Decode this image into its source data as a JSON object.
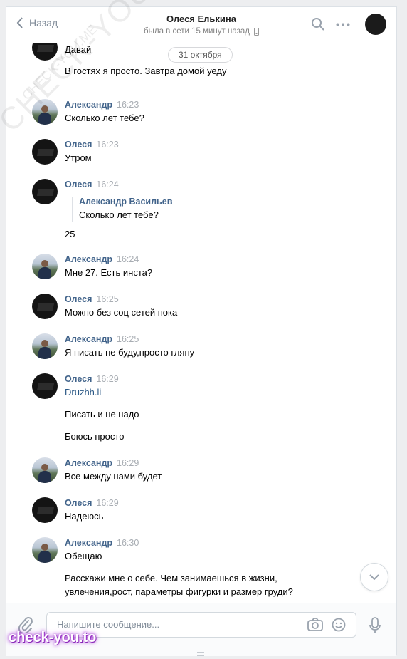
{
  "header": {
    "back_label": "Назад",
    "peer_name": "Олеся Елькина",
    "peer_status": "была в сети 15 минут назад"
  },
  "date_divider": "31 октября",
  "messages": [
    {
      "author": "",
      "time": "",
      "avatar": "dark",
      "lines": [
        "Давай",
        "В гостях я просто. Завтра домой уеду"
      ]
    },
    {
      "author": "Александр",
      "time": "16:23",
      "avatar": "photo",
      "lines": [
        "Сколько лет тебе?"
      ]
    },
    {
      "author": "Олеся",
      "time": "16:23",
      "avatar": "dark",
      "lines": [
        "Утром"
      ]
    },
    {
      "author": "Олеся",
      "time": "16:24",
      "avatar": "dark",
      "reply": {
        "author": "Александр Васильев",
        "text": "Сколько лет тебе?"
      },
      "lines": [
        "25"
      ]
    },
    {
      "author": "Александр",
      "time": "16:24",
      "avatar": "photo",
      "lines": [
        "Мне 27. Есть инста?"
      ]
    },
    {
      "author": "Олеся",
      "time": "16:25",
      "avatar": "dark",
      "lines": [
        "Можно без соц сетей пока"
      ]
    },
    {
      "author": "Александр",
      "time": "16:25",
      "avatar": "photo",
      "lines": [
        "Я писать не буду,просто гляну"
      ]
    },
    {
      "author": "Олеся",
      "time": "16:29",
      "avatar": "dark",
      "lines": [
        "Druzhh.li",
        "Писать и не надо",
        "Боюсь просто"
      ]
    },
    {
      "author": "Александр",
      "time": "16:29",
      "avatar": "photo",
      "lines": [
        "Все между нами будет"
      ]
    },
    {
      "author": "Олеся",
      "time": "16:29",
      "avatar": "dark",
      "lines": [
        "Надеюсь"
      ]
    },
    {
      "author": "Александр",
      "time": "16:30",
      "avatar": "photo",
      "lines": [
        "Обещаю",
        "Расскажи мне о себе. Чем занимаешься в жизни,",
        "увлечения,рост, параметры фигурки и размер груди?"
      ]
    }
  ],
  "composer": {
    "placeholder": "Напишите сообщение..."
  },
  "watermarks": {
    "diagonal_large": "CHECK-YOU.ME",
    "diagonal_small": "CHECK-YOU.ME",
    "badge": "check-you.to"
  },
  "icons": [
    "back-chevron-icon",
    "mobile-phone-icon",
    "search-icon",
    "more-dots-icon",
    "chevron-down-icon",
    "paperclip-icon",
    "camera-icon",
    "smile-icon",
    "microphone-icon"
  ]
}
